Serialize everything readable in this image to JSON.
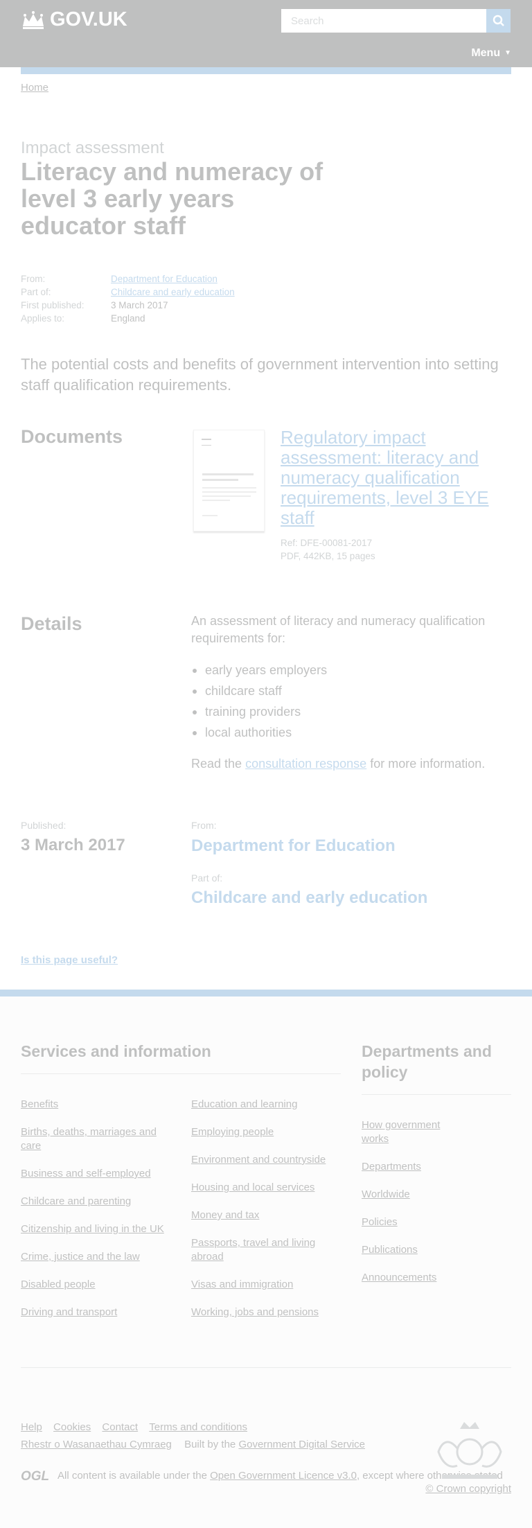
{
  "header": {
    "logo_text": "GOV.UK",
    "search_placeholder": "Search",
    "menu_label": "Menu",
    "accent": "#1d70b8"
  },
  "breadcrumb": {
    "home": "Home"
  },
  "page": {
    "caption": "Impact assessment",
    "title": "Literacy and numeracy of level 3 early years educator staff",
    "meta": [
      {
        "key": "From:",
        "value": "Department for Education",
        "link": true
      },
      {
        "key": "Part of:",
        "value": "Childcare and early education",
        "link": true
      },
      {
        "key": "First published:",
        "value": "3 March 2017",
        "link": false
      },
      {
        "key": "Applies to:",
        "value": "England",
        "link": false
      }
    ],
    "lead": "The potential costs and benefits of government intervention into setting staff qualification requirements."
  },
  "documents": {
    "heading": "Documents",
    "title": "Regulatory impact assessment: literacy and numeracy qualification requirements, level 3 EYE staff",
    "ref": "Ref: DFE-00081-2017",
    "info": "PDF, 442KB, 15 pages"
  },
  "details": {
    "heading": "Details",
    "intro": "An assessment of literacy and numeracy qualification requirements for:",
    "items": [
      "early years employers",
      "childcare staff",
      "training providers",
      "local authorities"
    ],
    "more_prefix": "Read the ",
    "more_link": "consultation response",
    "more_suffix": " for more information."
  },
  "published": {
    "published_label": "Published:",
    "published_date": "3 March 2017",
    "from_label": "From:",
    "from_value": "Department for Education",
    "part_label": "Part of:",
    "part_value": "Childcare and early education"
  },
  "feedback": {
    "question": "Is this page useful?"
  },
  "footer": {
    "services_heading": "Services and information",
    "services_col1": [
      "Benefits",
      "Births, deaths, marriages and care",
      "Business and self-employed",
      "Childcare and parenting",
      "Citizenship and living in the UK",
      "Crime, justice and the law",
      "Disabled people",
      "Driving and transport"
    ],
    "services_col2": [
      "Education and learning",
      "Employing people",
      "Environment and countryside",
      "Housing and local services",
      "Money and tax",
      "Passports, travel and living abroad",
      "Visas and immigration",
      "Working, jobs and pensions"
    ],
    "depts_heading": "Departments and policy",
    "depts_links": [
      "How government works",
      "Departments",
      "Worldwide",
      "Policies",
      "Publications",
      "Announcements"
    ],
    "bottom_links": [
      "Help",
      "Cookies",
      "Contact",
      "Terms and conditions"
    ],
    "welsh_link": "Rhestr o Wasanaethau Cymraeg",
    "built_by_prefix": "Built by the ",
    "built_by_link": "Government Digital Service",
    "ogl": "OGL",
    "licence_prefix": "All content is available under the ",
    "licence_link": "Open Government Licence v3.0",
    "licence_suffix": ", except where otherwise stated",
    "copyright": "© Crown copyright"
  }
}
